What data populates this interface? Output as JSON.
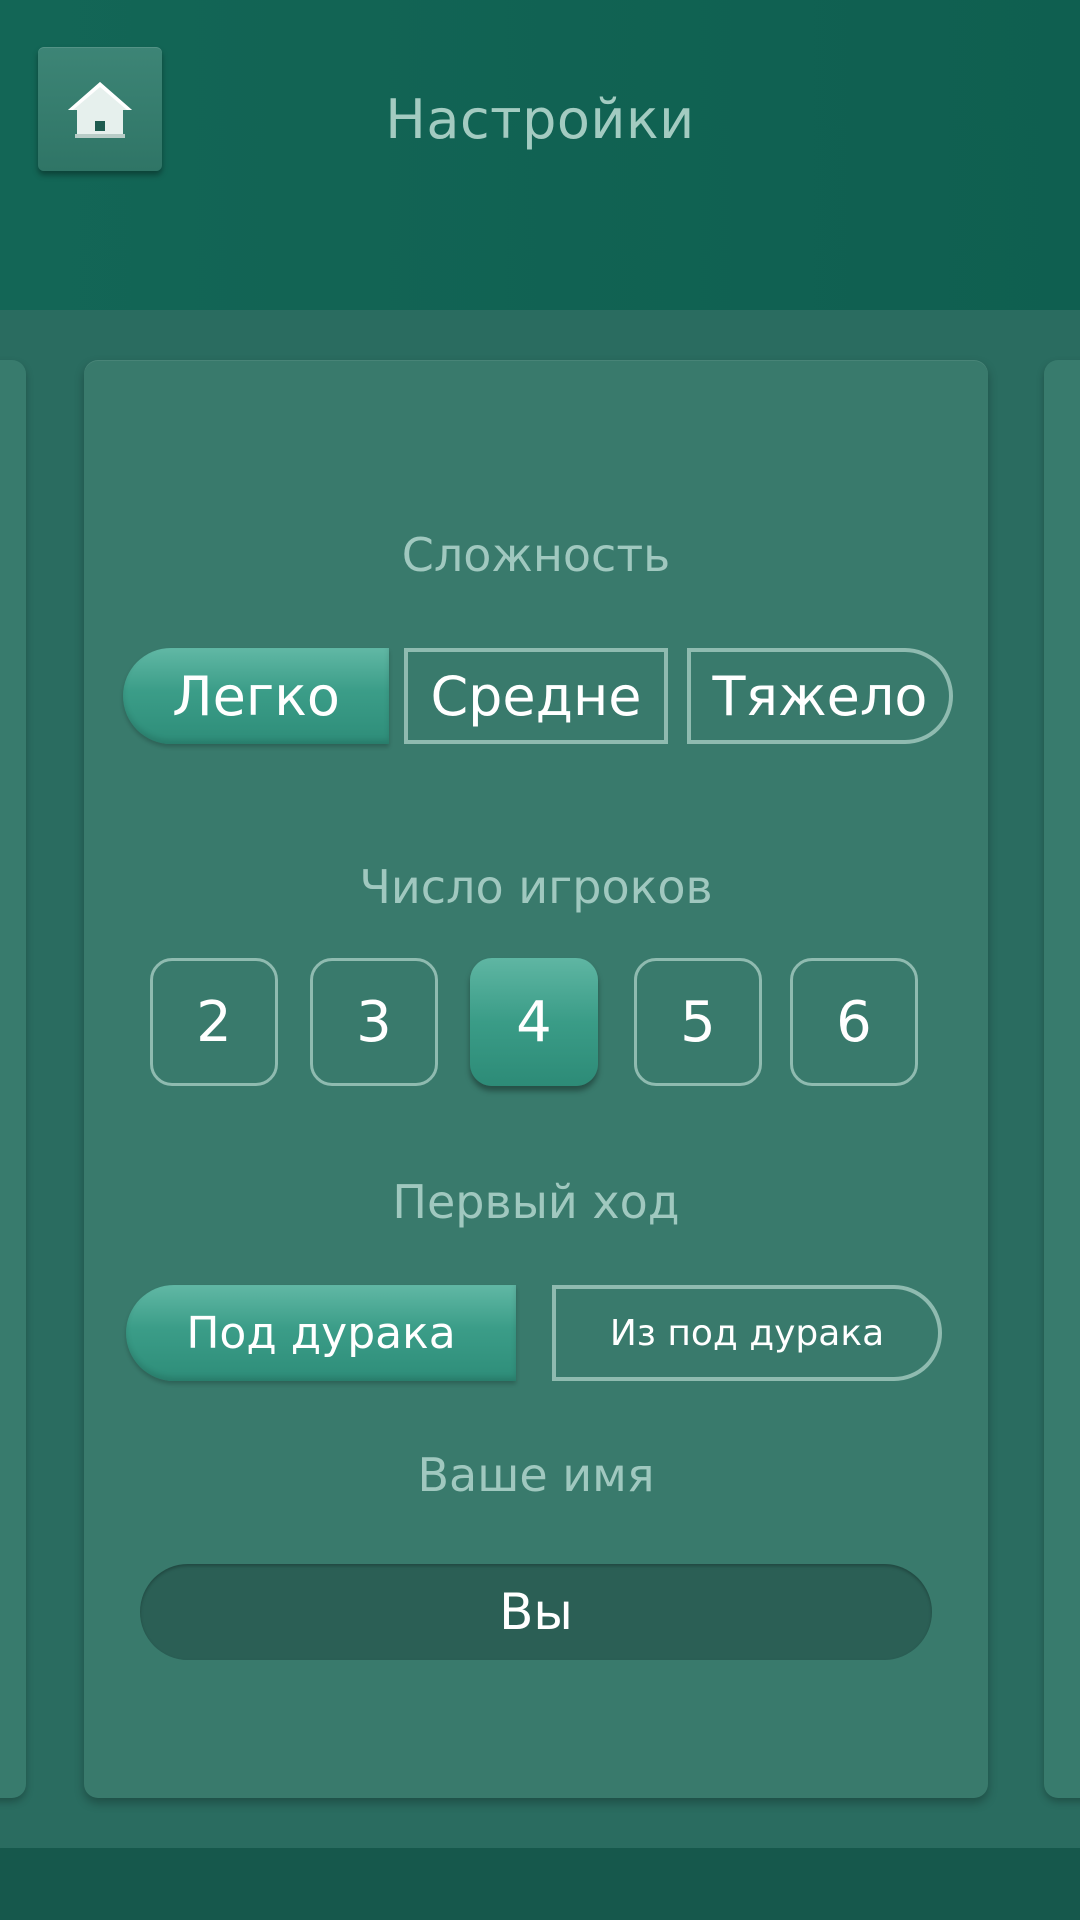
{
  "header": {
    "title": "Настройки",
    "home_icon": "home-icon"
  },
  "difficulty": {
    "label": "Сложность",
    "options": [
      "Легко",
      "Средне",
      "Тяжело"
    ],
    "selected": "Легко"
  },
  "players": {
    "label": "Число игроков",
    "options": [
      "2",
      "3",
      "4",
      "5",
      "6"
    ],
    "selected": "4"
  },
  "first_move": {
    "label": "Первый ход",
    "options": [
      "Под дурака",
      "Из под дурака"
    ],
    "selected": "Под дурака"
  },
  "name": {
    "label": "Ваше имя",
    "value": "Вы"
  },
  "colors": {
    "header_bg": "#136656",
    "card_bg": "#397a6c",
    "accent": "#3b9d88",
    "label_text": "#a0c8bf"
  }
}
